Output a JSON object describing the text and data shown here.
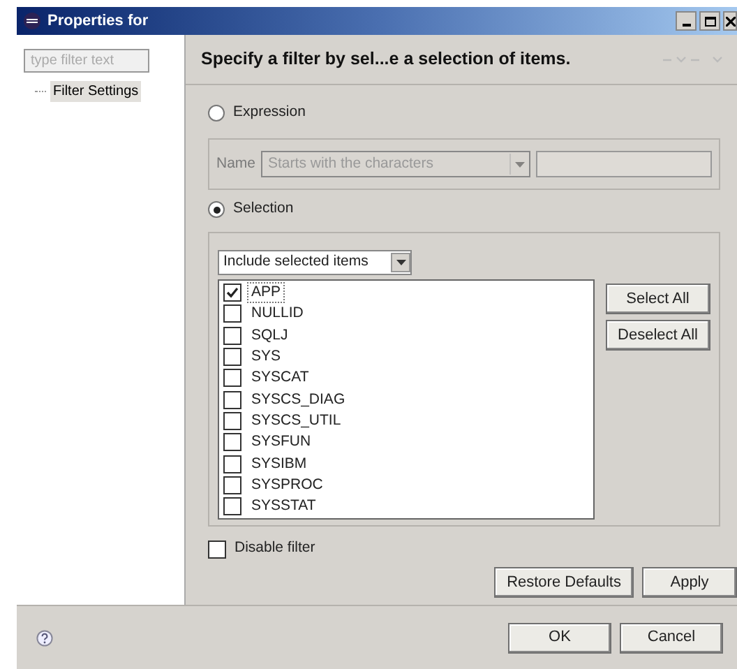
{
  "window": {
    "title": "Properties for"
  },
  "sidebar": {
    "filter": {
      "placeholder": "type filter text"
    },
    "items": [
      {
        "label": "Filter Settings",
        "selected": true
      }
    ]
  },
  "header": {
    "title": "Specify a filter by sel...e a selection of items."
  },
  "modes": [
    {
      "label": "Expression",
      "selected": false
    },
    {
      "label": "Selection",
      "selected": true
    }
  ],
  "expression": {
    "name_label": "Name",
    "operator": "Starts with the characters",
    "disabled": true
  },
  "selection": {
    "mode": "Include selected items",
    "items": [
      {
        "label": "APP",
        "checked": true,
        "selected": true
      },
      {
        "label": "NULLID",
        "checked": false,
        "selected": false
      },
      {
        "label": "SQLJ",
        "checked": false,
        "selected": false
      },
      {
        "label": "SYS",
        "checked": false,
        "selected": false
      },
      {
        "label": "SYSCAT",
        "checked": false,
        "selected": false
      },
      {
        "label": "SYSCS_DIAG",
        "checked": false,
        "selected": false
      },
      {
        "label": "SYSCS_UTIL",
        "checked": false,
        "selected": false
      },
      {
        "label": "SYSFUN",
        "checked": false,
        "selected": false
      },
      {
        "label": "SYSIBM",
        "checked": false,
        "selected": false
      },
      {
        "label": "SYSPROC",
        "checked": false,
        "selected": false
      },
      {
        "label": "SYSSTAT",
        "checked": false,
        "selected": false
      }
    ],
    "buttons": [
      "Select All",
      "Deselect All"
    ]
  },
  "disable_filter": {
    "label": "Disable filter",
    "checked": false
  },
  "page_buttons": [
    "Restore Defaults",
    "Apply"
  ],
  "dialog_buttons": [
    "OK",
    "Cancel"
  ]
}
